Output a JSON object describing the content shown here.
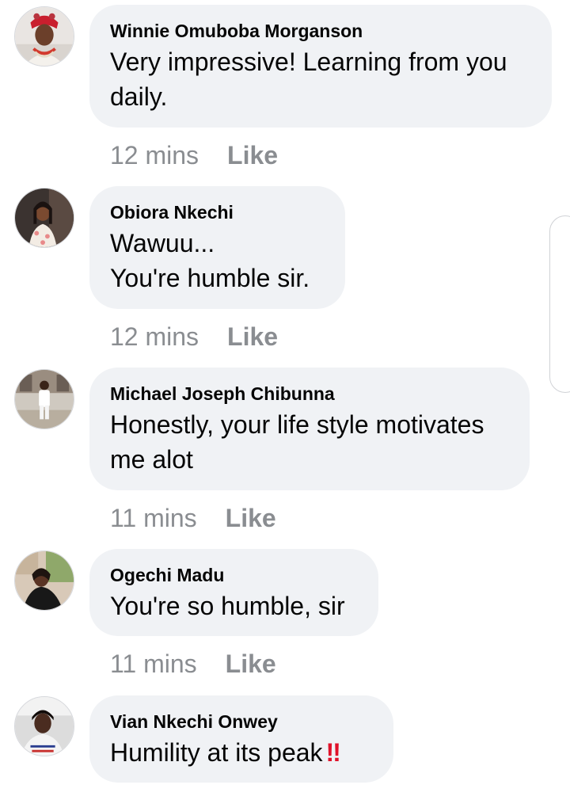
{
  "comments": [
    {
      "author": "Winnie Omuboba Morganson",
      "text_lines": [
        "Very impressive! Learning from you",
        "daily."
      ],
      "time": "12 mins",
      "like": "Like",
      "avatar_icon": "profile-photo-woman-red-headdress"
    },
    {
      "author": "Obiora Nkechi",
      "text_lines": [
        "Wawuu...",
        "You're humble sir."
      ],
      "time": "12 mins",
      "like": "Like",
      "avatar_icon": "profile-photo-woman-floral-dress"
    },
    {
      "author": "Michael Joseph Chibunna",
      "text_lines": [
        "Honestly, your life style motivates",
        "me alot"
      ],
      "time": "11 mins",
      "like": "Like",
      "avatar_icon": "profile-photo-man-white-outfit"
    },
    {
      "author": "Ogechi Madu",
      "text_lines": [
        "You're so humble, sir"
      ],
      "time": "11 mins",
      "like": "Like",
      "avatar_icon": "profile-photo-woman-outdoors"
    },
    {
      "author": "Vian Nkechi Onwey",
      "text_lines": [
        "Humility at its peak"
      ],
      "emoji": "‼",
      "time": "",
      "like": "",
      "avatar_icon": "profile-photo-woman-selfie"
    }
  ],
  "colors": {
    "bubble_bg": "#f0f2f5",
    "meta_text": "#8a8d91",
    "name_text": "#050505",
    "emoji_red": "#e0122a"
  }
}
